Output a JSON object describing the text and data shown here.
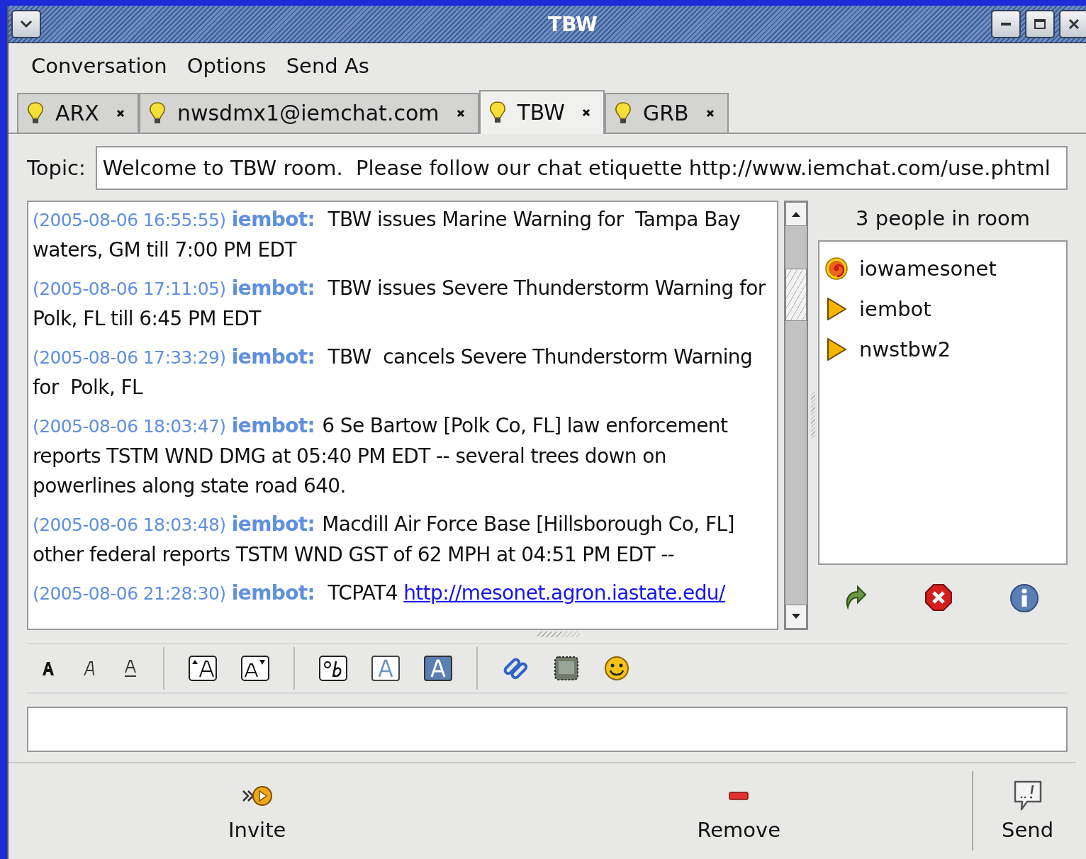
{
  "window": {
    "title": "TBW"
  },
  "menu": [
    "Conversation",
    "Options",
    "Send As"
  ],
  "tabs": [
    {
      "label": "ARX",
      "selected": false
    },
    {
      "label": "nwsdmx1@iemchat.com",
      "selected": false
    },
    {
      "label": "TBW",
      "selected": true
    },
    {
      "label": "GRB",
      "selected": false
    }
  ],
  "topic": {
    "label": "Topic:",
    "value": "Welcome to TBW room.  Please follow our chat etiquette http://www.iemchat.com/use.phtml"
  },
  "messages": [
    {
      "time": "(2005-08-06 16:55:55)",
      "sender": "iembot:",
      "text": " TBW issues Marine Warning for  Tampa Bay waters, GM till 7:00 PM EDT"
    },
    {
      "time": "(2005-08-06 17:11:05)",
      "sender": "iembot:",
      "text": " TBW issues Severe Thunderstorm Warning for  Polk, FL till 6:45 PM EDT"
    },
    {
      "time": "(2005-08-06 17:33:29)",
      "sender": "iembot:",
      "text": " TBW  cancels Severe Thunderstorm Warning for  Polk, FL"
    },
    {
      "time": "(2005-08-06 18:03:47)",
      "sender": "iembot:",
      "text": "6 Se Bartow [Polk Co, FL] law enforcement reports TSTM WND DMG at 05:40 PM EDT -- several trees down on powerlines along state road 640."
    },
    {
      "time": "(2005-08-06 18:03:48)",
      "sender": "iembot:",
      "text": "Macdill Air Force Base [Hillsborough Co, FL] other federal reports TSTM WND GST of 62 MPH at 04:51 PM EDT --"
    },
    {
      "time": "(2005-08-06 21:28:30)",
      "sender": "iembot:",
      "text": " TCPAT4",
      "link": "http://mesonet.agron.iastate.edu/"
    }
  ],
  "people": {
    "count_label": "3 people in room",
    "members": [
      {
        "name": "iowamesonet",
        "kind": "moderator"
      },
      {
        "name": "iembot",
        "kind": "participant"
      },
      {
        "name": "nwstbw2",
        "kind": "participant"
      }
    ]
  },
  "buttons": [
    {
      "label": "Invite",
      "kind": "invite"
    },
    {
      "label": "Remove",
      "kind": "remove"
    },
    {
      "label": "Send",
      "kind": "send"
    }
  ]
}
